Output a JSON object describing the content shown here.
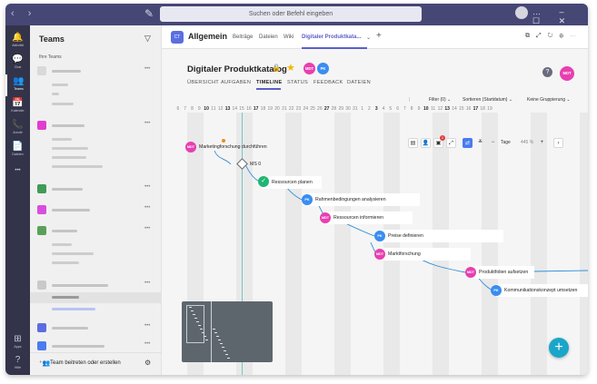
{
  "titlebar": {
    "nav": "‹ ›",
    "search_placeholder": "Suchen oder Befehl eingeben",
    "controls": "… – ☐ ✕"
  },
  "rail": [
    {
      "label": "Aktivität",
      "icon": "bell-icon",
      "glyph": "🔔"
    },
    {
      "label": "Chat",
      "icon": "chat-icon",
      "glyph": "💬"
    },
    {
      "label": "Teams",
      "icon": "teams-icon",
      "glyph": "👥"
    },
    {
      "label": "Kalender",
      "icon": "calendar-icon",
      "glyph": "📅"
    },
    {
      "label": "Anrufe",
      "icon": "phone-icon",
      "glyph": "📞"
    },
    {
      "label": "Dateien",
      "icon": "file-icon",
      "glyph": "📄"
    },
    {
      "label": "",
      "icon": "more-icon",
      "glyph": "•••"
    },
    {
      "label": "Apps",
      "icon": "apps-icon",
      "glyph": "⊞"
    },
    {
      "label": "Hilfe",
      "icon": "help-icon",
      "glyph": "?"
    }
  ],
  "sidebar": {
    "title": "Teams",
    "section": "Ihre Teams",
    "selected_channel": "Allgemein",
    "footer_label": "Team beitreten oder erstellen"
  },
  "channel": {
    "badge": "CT",
    "name": "Allgemein",
    "tabs": [
      "Beiträge",
      "Dateien",
      "Wiki",
      "Digitaler Produktkata..."
    ],
    "active_tab": "Digitaler Produktkata..."
  },
  "project": {
    "title": "Digitaler Produktkatalog",
    "avatars": [
      {
        "initials": "MDT",
        "color": "#e83fb0"
      },
      {
        "initials": "PK",
        "color": "#3a8df0"
      }
    ],
    "owner_avatar": {
      "initials": "MDT",
      "color": "#e83fb0"
    },
    "tabs": [
      "ÜBERSICHT",
      "AUFGABEN",
      "TIMELINE",
      "STATUS",
      "FEEDBACK",
      "DATEIEN"
    ],
    "active_tab": "TIMELINE"
  },
  "filters": {
    "filter": "Filter (0) ⌄",
    "sort": "Sortieren (Startdatum) ⌄",
    "group": "Keine Gruppierung ⌄"
  },
  "timeline": {
    "days": [
      "6",
      "7",
      "8",
      "9",
      "10",
      "11",
      "12",
      "13",
      "14",
      "15",
      "16",
      "17",
      "18",
      "19",
      "20",
      "21",
      "22",
      "23",
      "24",
      "25",
      "26",
      "27",
      "28",
      "29",
      "30",
      "31",
      "1",
      "2",
      "3",
      "4",
      "5",
      "6",
      "7",
      "8",
      "9",
      "10",
      "11",
      "12",
      "13",
      "14",
      "15",
      "16",
      "17",
      "18",
      "19"
    ],
    "bold_days": [
      "13",
      "27",
      "3",
      "10",
      "17"
    ],
    "zoom_unit": "Tage",
    "zoom_value": "445 %",
    "notification_count": "1",
    "milestone": "MS 0",
    "tasks": [
      {
        "label": "Marketingforschung durchführen",
        "initials": "MDT",
        "color": "#e83fb0"
      },
      {
        "label": "Ressourcen planen",
        "initials": "✓",
        "color": "#21b573"
      },
      {
        "label": "Rahmenbedingungen analysieren",
        "initials": "PK",
        "color": "#3a8df0"
      },
      {
        "label": "Ressourcen informieren",
        "initials": "MDT",
        "color": "#e83fb0"
      },
      {
        "label": "Preise definieren",
        "initials": "PK",
        "color": "#3a8df0"
      },
      {
        "label": "Marktforschung",
        "initials": "MDT",
        "color": "#e83fb0"
      },
      {
        "label": "Produktfolien aufsetzen",
        "initials": "MDT",
        "color": "#e83fb0"
      },
      {
        "label": "Kommunikationskonzept umsetzen",
        "initials": "PK",
        "color": "#3a8df0"
      }
    ]
  },
  "colors": {
    "titlebar": "#464775",
    "rail": "#33344a",
    "accent": "#5b5fc7",
    "today_line": "#74c8c0",
    "connector": "#2c8dd6",
    "fab": "#1aa6c9"
  }
}
